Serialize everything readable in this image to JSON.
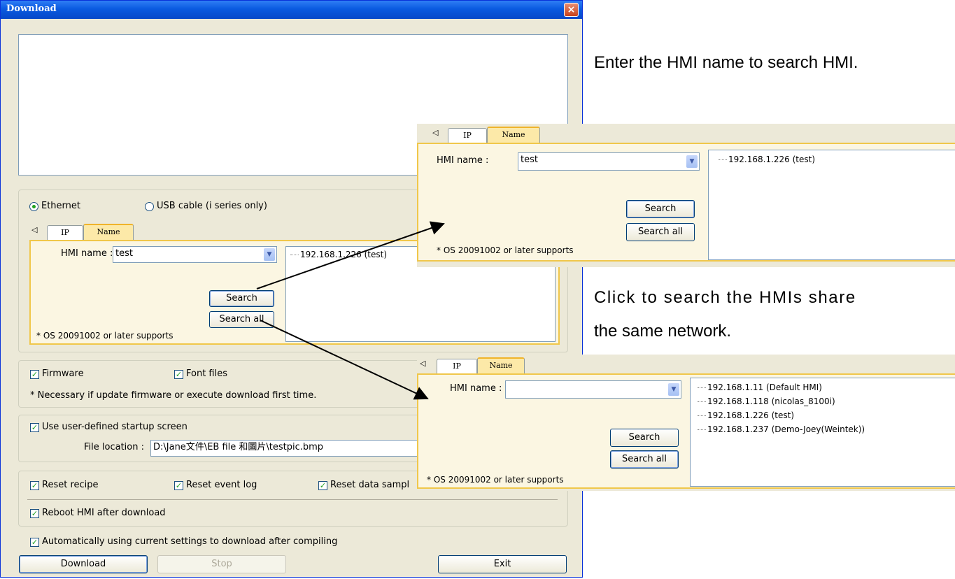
{
  "window": {
    "title": "Download",
    "close": "×"
  },
  "connection": {
    "ethernet": "Ethernet",
    "usb": "USB cable (i series only)"
  },
  "tabs": {
    "scroll": "◁",
    "ip": "IP",
    "name": "Name"
  },
  "main_panel": {
    "hmi_label": "HMI name :",
    "hmi_value": "test",
    "results": [
      "192.168.1.226 (test)"
    ],
    "search": "Search",
    "search_all": "Search all",
    "note": "* OS 20091002 or later supports"
  },
  "options": {
    "firmware": "Firmware",
    "font_files": "Font files",
    "note": "* Necessary if update firmware or execute download first time.",
    "use_startup": "Use user-defined startup screen",
    "file_location_label": "File location :",
    "file_location_value": "D:\\Jane文件\\EB file 和圖片\\testpic.bmp",
    "reset_recipe": "Reset recipe",
    "reset_event_log": "Reset event log",
    "reset_data_sampling": "Reset data sampl",
    "reboot": "Reboot HMI after download",
    "auto": "Automatically using current settings to download after compiling"
  },
  "buttons": {
    "download": "Download",
    "stop": "Stop",
    "exit": "Exit"
  },
  "inset1": {
    "hmi_label": "HMI name :",
    "hmi_value": "test",
    "results": [
      "192.168.1.226 (test)"
    ],
    "search": "Search",
    "search_all": "Search all",
    "note": "* OS 20091002 or later supports"
  },
  "inset2": {
    "hmi_label": "HMI name :",
    "hmi_value": "",
    "results": [
      "192.168.1.11 (Default HMI)",
      "192.168.1.118 (nicolas_8100i)",
      "192.168.1.226 (test)",
      "192.168.1.237 (Demo-Joey(Weintek))"
    ],
    "search": "Search",
    "search_all": "Search all",
    "note": "* OS 20091002 or later supports"
  },
  "annotations": {
    "enter_name": "Enter the HMI name to search HMI.",
    "click_search_1": "Click to search the HMIs share",
    "click_search_2": "the same network."
  },
  "colors": {
    "title_bar": "#0a5ae0",
    "tab_highlight": "#f0c74a",
    "window_bg": "#ece9d8"
  }
}
